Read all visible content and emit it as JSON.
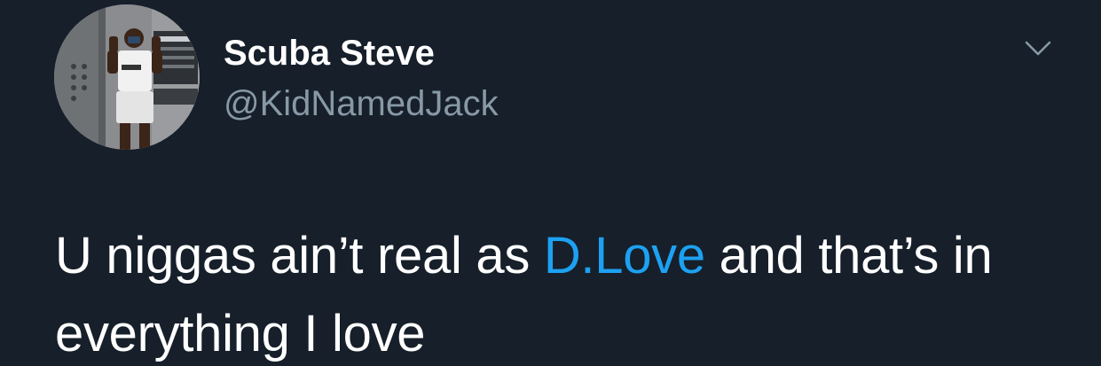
{
  "tweet": {
    "author": {
      "display_name": "Scuba Steve",
      "handle": "@KidNamedJack"
    },
    "menu_icon": "chevron-down-icon",
    "text": {
      "part1": "U niggas ain’t real as ",
      "mention": "D.Love",
      "part2": " and that’s in everything I love"
    }
  },
  "colors": {
    "background": "#15202b",
    "primary_text": "#ffffff",
    "secondary_text": "#8899a6",
    "link": "#1da1f2"
  }
}
